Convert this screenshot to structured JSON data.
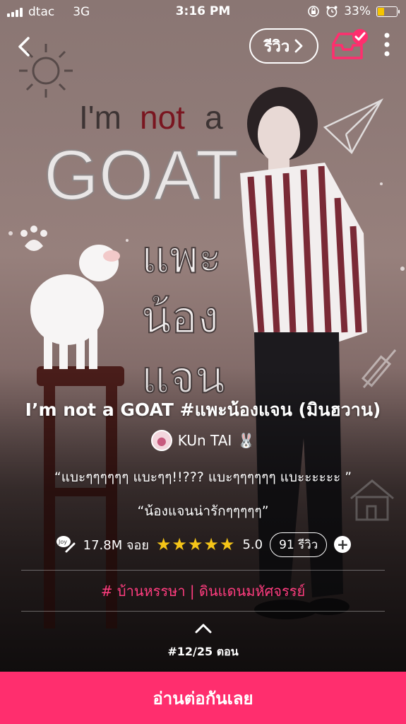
{
  "status_bar": {
    "carrier": "dtac",
    "network": "3G",
    "time": "3:16 PM",
    "battery": "33%",
    "battery_level": 0.33
  },
  "nav": {
    "review_label": "รีวิว"
  },
  "cover_art": {
    "line1_a": "I'm",
    "line1_not": "not",
    "line1_b": "a",
    "line2": "GOAT",
    "line3": "แพะ",
    "line4": "น้อง",
    "line5": "แจน"
  },
  "story": {
    "title": "I’m not a GOAT #แพะน้องแจน (มินฮวาน)",
    "author": "KUn TAI",
    "tagline1": "“แบะๆๆๆๆๆๆ แบะๆๆ!!??? แบะๆๆๆๆๆๆ แบะะะะะะ ”",
    "tagline2": "“น้องแจนน่ารักๆๆๆๆๆ”",
    "views": "17.8M จอย",
    "rating": "5.0",
    "rating_value": 5,
    "reviews": "91 รีวิว",
    "category_hash": "#",
    "category": "บ้านหรรษา | ดินแดนมหัศจรรย์",
    "episode": "#12/25 ตอน"
  },
  "cta": {
    "read_label": "อ่านต่อกันเลย"
  },
  "colors": {
    "accent": "#ff2e6e",
    "star": "#f5c518",
    "battery": "#f5c400"
  }
}
